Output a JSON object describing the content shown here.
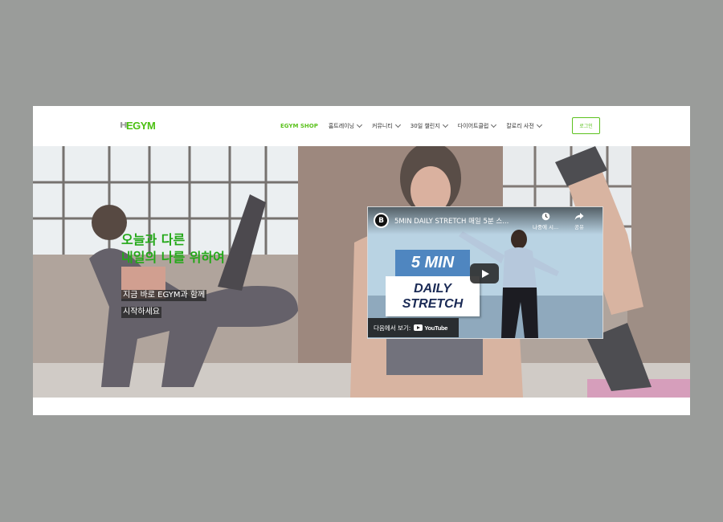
{
  "header": {
    "logo_text": "EGYM",
    "nav": [
      {
        "label": "EGYM SHOP",
        "active": true,
        "dropdown": false
      },
      {
        "label": "홈트레이닝",
        "active": false,
        "dropdown": true
      },
      {
        "label": "커뮤니티",
        "active": false,
        "dropdown": true
      },
      {
        "label": "30일 챌린지",
        "active": false,
        "dropdown": true
      },
      {
        "label": "다이어트클럽",
        "active": false,
        "dropdown": true
      },
      {
        "label": "칼로리 사전",
        "active": false,
        "dropdown": true
      }
    ],
    "login_label": "로그인"
  },
  "hero": {
    "headline_line1": "오늘과 다른",
    "headline_line2": "내일의 나를 위하여",
    "sub_line1": "지금 바로 EGYM과 함께",
    "sub_line2": "시작하세요"
  },
  "video": {
    "channel_letter": "B",
    "title": "5MIN DAILY STRETCH 매일 5분 스...",
    "watch_later_label": "나중에 시...",
    "share_label": "공유",
    "thumb_line1": "5 MIN",
    "thumb_line2": "DAILY",
    "thumb_line3": "STRETCH",
    "watch_on_label": "다음에서 보기:",
    "youtube_word": "YouTube"
  },
  "colors": {
    "brand_green": "#5cc21e",
    "headline_green": "#23a818",
    "backdrop_gray": "#9a9c9a"
  }
}
